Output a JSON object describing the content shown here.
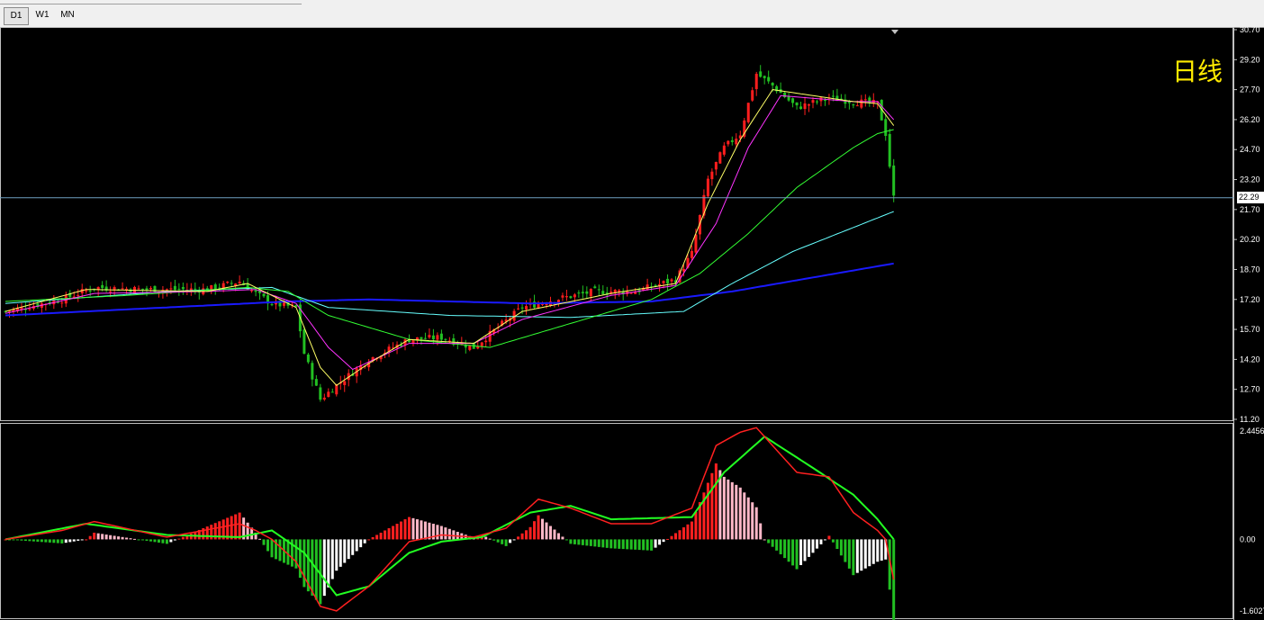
{
  "toolbar": {
    "timeframes": [
      {
        "label": "D1",
        "active": true
      },
      {
        "label": "W1",
        "active": false
      },
      {
        "label": "MN",
        "active": false
      }
    ]
  },
  "chart_data": {
    "type": "candlestick",
    "timeframe_label": "日线",
    "current_price": 22.29,
    "current_price_label": "22.29",
    "colors": {
      "background": "#000000",
      "candle_up": "#ff1e1e",
      "candle_down": "#22c022",
      "ma5": "#ffff66",
      "ma10": "#ff33ff",
      "ma30": "#33ff33",
      "ma60": "#66ffff",
      "ma120": "#1a1aff",
      "macd_dif": "#ff2020",
      "macd_dea": "#22ff22",
      "price_line": "#6fa0c0"
    },
    "price_axis": {
      "ylim": [
        11.2,
        30.7
      ],
      "ticks": [
        "30.70",
        "29.20",
        "27.70",
        "26.20",
        "24.70",
        "23.20",
        "21.70",
        "20.20",
        "18.70",
        "17.20",
        "15.70",
        "14.20",
        "12.70",
        "11.20"
      ]
    },
    "macd_axis": {
      "ylim": [
        -1.6027,
        2.4456
      ],
      "ticks": [
        "2.4456",
        "0.00",
        "-1.6027"
      ]
    },
    "price_series": {
      "x_range": [
        0,
        220
      ],
      "close_knots": [
        [
          0,
          16.6
        ],
        [
          14,
          17.2
        ],
        [
          22,
          17.8
        ],
        [
          35,
          17.7
        ],
        [
          50,
          17.7
        ],
        [
          58,
          18.1
        ],
        [
          62,
          17.5
        ],
        [
          66,
          17.0
        ],
        [
          72,
          16.8
        ],
        [
          74,
          14.5
        ],
        [
          78,
          12.2
        ],
        [
          82,
          12.9
        ],
        [
          90,
          14.2
        ],
        [
          100,
          15.2
        ],
        [
          108,
          15.3
        ],
        [
          116,
          14.8
        ],
        [
          122,
          15.8
        ],
        [
          128,
          16.8
        ],
        [
          136,
          17.2
        ],
        [
          146,
          17.6
        ],
        [
          156,
          17.6
        ],
        [
          166,
          18.2
        ],
        [
          170,
          19.5
        ],
        [
          174,
          23.2
        ],
        [
          178,
          24.8
        ],
        [
          182,
          25.5
        ],
        [
          186,
          28.5
        ],
        [
          190,
          27.9
        ],
        [
          196,
          26.8
        ],
        [
          204,
          27.3
        ],
        [
          210,
          27.1
        ],
        [
          216,
          27.0
        ],
        [
          218,
          25.5
        ],
        [
          220,
          22.29
        ]
      ],
      "ma5_knots": [
        [
          0,
          16.6
        ],
        [
          20,
          17.7
        ],
        [
          50,
          17.6
        ],
        [
          60,
          18.0
        ],
        [
          66,
          17.4
        ],
        [
          72,
          16.8
        ],
        [
          78,
          13.8
        ],
        [
          82,
          12.9
        ],
        [
          90,
          14.0
        ],
        [
          100,
          15.2
        ],
        [
          116,
          15.0
        ],
        [
          128,
          16.6
        ],
        [
          150,
          17.5
        ],
        [
          166,
          18.0
        ],
        [
          174,
          22.0
        ],
        [
          182,
          25.2
        ],
        [
          190,
          27.7
        ],
        [
          210,
          27.1
        ],
        [
          216,
          27.0
        ],
        [
          220,
          25.9
        ]
      ],
      "ma10_knots": [
        [
          0,
          16.5
        ],
        [
          22,
          17.5
        ],
        [
          50,
          17.6
        ],
        [
          62,
          17.7
        ],
        [
          72,
          17.0
        ],
        [
          80,
          14.8
        ],
        [
          86,
          13.7
        ],
        [
          100,
          15.0
        ],
        [
          116,
          15.0
        ],
        [
          128,
          16.2
        ],
        [
          150,
          17.4
        ],
        [
          166,
          17.9
        ],
        [
          176,
          21.0
        ],
        [
          184,
          24.8
        ],
        [
          192,
          27.4
        ],
        [
          210,
          27.1
        ],
        [
          216,
          27.1
        ],
        [
          220,
          26.2
        ]
      ],
      "ma30_knots": [
        [
          0,
          17.1
        ],
        [
          30,
          17.4
        ],
        [
          60,
          17.8
        ],
        [
          70,
          17.6
        ],
        [
          80,
          16.4
        ],
        [
          100,
          15.2
        ],
        [
          120,
          14.8
        ],
        [
          140,
          16.0
        ],
        [
          160,
          17.2
        ],
        [
          172,
          18.5
        ],
        [
          184,
          20.5
        ],
        [
          196,
          22.8
        ],
        [
          210,
          24.8
        ],
        [
          216,
          25.5
        ],
        [
          220,
          25.7
        ]
      ],
      "ma60_knots": [
        [
          0,
          17.0
        ],
        [
          40,
          17.6
        ],
        [
          66,
          17.8
        ],
        [
          80,
          16.8
        ],
        [
          110,
          16.4
        ],
        [
          140,
          16.3
        ],
        [
          168,
          16.6
        ],
        [
          180,
          18.0
        ],
        [
          195,
          19.6
        ],
        [
          210,
          20.8
        ],
        [
          220,
          21.6
        ]
      ],
      "ma120_knots": [
        [
          0,
          16.4
        ],
        [
          40,
          16.8
        ],
        [
          70,
          17.1
        ],
        [
          90,
          17.2
        ],
        [
          130,
          17.0
        ],
        [
          160,
          17.1
        ],
        [
          180,
          17.6
        ],
        [
          200,
          18.3
        ],
        [
          220,
          19.0
        ]
      ]
    },
    "macd_series": {
      "dif_knots": [
        [
          0,
          0.0
        ],
        [
          14,
          0.2
        ],
        [
          22,
          0.4
        ],
        [
          40,
          0.05
        ],
        [
          58,
          0.35
        ],
        [
          62,
          0.2
        ],
        [
          66,
          0.0
        ],
        [
          72,
          -0.5
        ],
        [
          78,
          -1.5
        ],
        [
          82,
          -1.6
        ],
        [
          90,
          -1.05
        ],
        [
          100,
          -0.05
        ],
        [
          108,
          0.1
        ],
        [
          116,
          0.05
        ],
        [
          124,
          0.25
        ],
        [
          132,
          0.9
        ],
        [
          140,
          0.7
        ],
        [
          150,
          0.35
        ],
        [
          160,
          0.35
        ],
        [
          170,
          0.7
        ],
        [
          176,
          2.1
        ],
        [
          182,
          2.4
        ],
        [
          186,
          2.5
        ],
        [
          196,
          1.5
        ],
        [
          204,
          1.4
        ],
        [
          210,
          0.6
        ],
        [
          216,
          0.2
        ],
        [
          218,
          0.0
        ],
        [
          220,
          -0.9
        ]
      ],
      "dea_knots": [
        [
          0,
          0.0
        ],
        [
          20,
          0.35
        ],
        [
          40,
          0.1
        ],
        [
          58,
          0.05
        ],
        [
          66,
          0.2
        ],
        [
          74,
          -0.3
        ],
        [
          82,
          -1.25
        ],
        [
          90,
          -1.05
        ],
        [
          100,
          -0.3
        ],
        [
          108,
          -0.05
        ],
        [
          118,
          0.05
        ],
        [
          130,
          0.6
        ],
        [
          140,
          0.75
        ],
        [
          150,
          0.45
        ],
        [
          170,
          0.5
        ],
        [
          178,
          1.5
        ],
        [
          188,
          2.3
        ],
        [
          200,
          1.6
        ],
        [
          210,
          1.0
        ],
        [
          216,
          0.45
        ],
        [
          220,
          0.0
        ]
      ]
    }
  }
}
